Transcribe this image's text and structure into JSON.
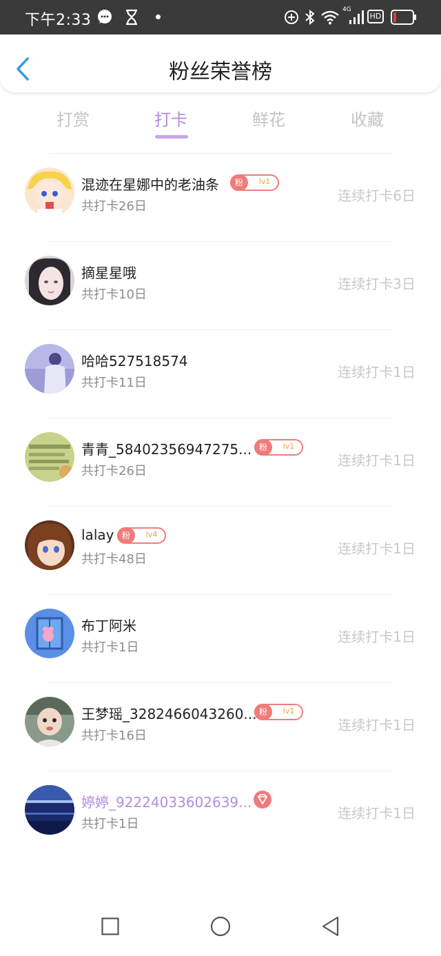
{
  "status_bar": {
    "time": "下午2:33",
    "network": "4G",
    "hd": "HD"
  },
  "header": {
    "title": "粉丝荣誉榜"
  },
  "tabs": [
    {
      "label": "打赏",
      "active": false
    },
    {
      "label": "打卡",
      "active": true
    },
    {
      "label": "鲜花",
      "active": false
    },
    {
      "label": "收藏",
      "active": false
    }
  ],
  "rows": [
    {
      "name": "混迹在星娜中的老油条",
      "total": "共打卡26日",
      "streak": "连续打卡6日",
      "badge": {
        "fan": "粉",
        "level": "lv1"
      }
    },
    {
      "name": "摘星星哦",
      "total": "共打卡10日",
      "streak": "连续打卡3日"
    },
    {
      "name": "哈哈527518574",
      "total": "共打卡11日",
      "streak": "连续打卡1日"
    },
    {
      "name": "青青_58402356947275...",
      "total": "共打卡26日",
      "streak": "连续打卡1日",
      "badge": {
        "fan": "粉",
        "level": "lv1"
      }
    },
    {
      "name": "lalay",
      "total": "共打卡48日",
      "streak": "连续打卡1日",
      "badge": {
        "fan": "粉",
        "level": "lv4"
      }
    },
    {
      "name": "布丁阿米",
      "total": "共打卡1日",
      "streak": "连续打卡1日"
    },
    {
      "name": "王梦瑶_3282466043260...",
      "total": "共打卡16日",
      "streak": "连续打卡1日",
      "badge": {
        "fan": "粉",
        "level": "lv1"
      }
    },
    {
      "name": "婷婷_92224033602639...",
      "total": "共打卡1日",
      "streak": "连续打卡1日",
      "vip": true
    }
  ],
  "colors": {
    "accent": "#b58be0",
    "badge": "#f17b7b",
    "level_text": "#f0a040",
    "back_arrow": "#3a9be8"
  }
}
